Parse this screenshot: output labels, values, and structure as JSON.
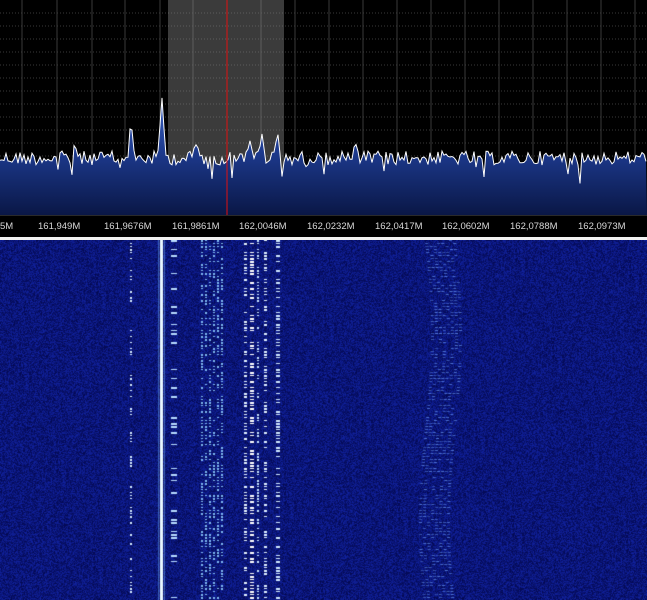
{
  "colors": {
    "background": "#000000",
    "spectrum_fill": "#1c3a8c",
    "spectrum_trace": "#ffffff",
    "grid": "#3a3a3a",
    "passband": "#8a8a8a",
    "center_marker": "#e01010",
    "waterfall_base": "#050c5a",
    "waterfall_signal": "#8fd0ff"
  },
  "freq_axis": {
    "ticks": [
      "5M",
      "161,949M",
      "161,9676M",
      "161,9861M",
      "162,0046M",
      "162,0232M",
      "162,0417M",
      "162,0602M",
      "162,0788M",
      "162,0973M"
    ]
  }
}
